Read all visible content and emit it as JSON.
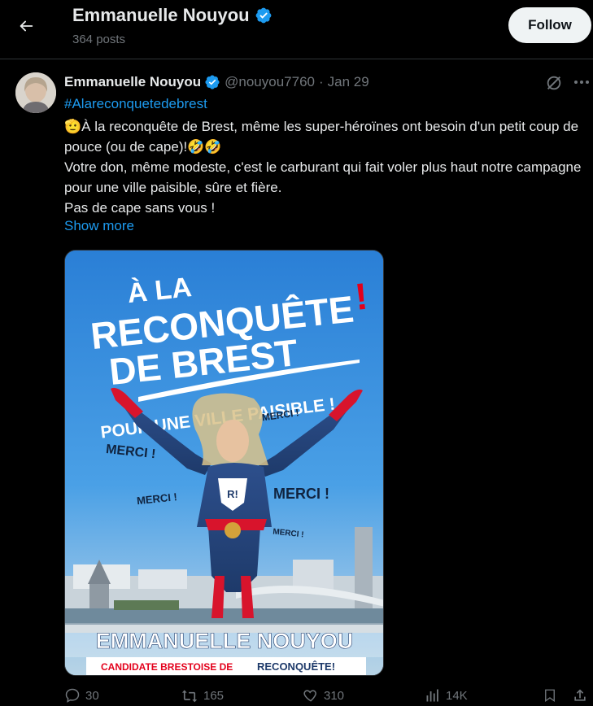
{
  "header": {
    "back_icon": "arrow-left-icon",
    "name": "Emmanuelle Nouyou",
    "posts": "364 posts",
    "follow_label": "Follow"
  },
  "tweet": {
    "author": "Emmanuelle Nouyou",
    "handle": "@nouyou7760",
    "separator": "·",
    "date": "Jan 29",
    "hashtag": "#Alareconquetedebrest",
    "lines": [
      "À la reconquête de Brest, même les super-héroïnes ont besoin d'un petit coup de pouce (ou de cape)!🤣🤣",
      "Votre don, même modeste, c'est le carburant qui fait voler plus haut notre campagne pour une ville paisible, sûre et fière.",
      "Pas de cape sans vous !"
    ],
    "show_more": "Show more",
    "emoji_prefix": "🫡"
  },
  "poster": {
    "line1": "À LA",
    "line2": "RECONQUÊTE",
    "exclaim": "!",
    "line3": "DE BREST",
    "subtitle": "POUR UNE VILLE PAISIBLE !",
    "merci1": "MERCI !",
    "merci2": "MERCI !",
    "merci3": "MERCI !",
    "merci4": "MERCI !",
    "merci5": "MERCI !",
    "name_banner": "EMMANUELLE NOUYOU",
    "candidate": "CANDIDATE BRESTOISE DE",
    "party": "RECONQUÊTE!",
    "badge": "R!"
  },
  "actions": {
    "replies": "30",
    "reposts": "165",
    "likes": "310",
    "views": "14K"
  },
  "colors": {
    "accent": "#1d9bf0",
    "muted": "#71767b",
    "text": "#e7e9ea",
    "verified": "#1d9bf0",
    "poster_red": "#e3001b"
  }
}
